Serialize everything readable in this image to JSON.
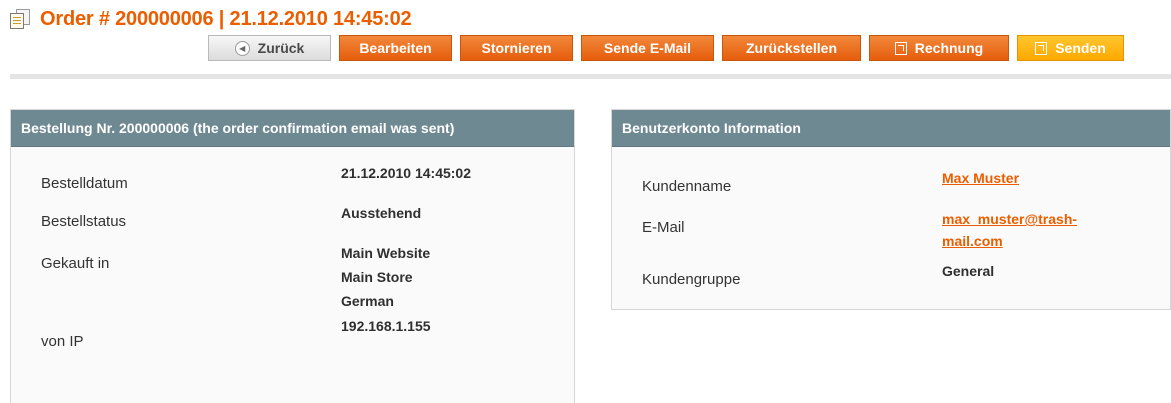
{
  "header": {
    "title": "Order # 200000006 | 21.12.2010 14:45:02",
    "icon": "order-document-icon"
  },
  "toolbar": {
    "back_label": "Zurück",
    "edit_label": "Bearbeiten",
    "cancel_label": "Stornieren",
    "send_email_label": "Sende E-Mail",
    "hold_label": "Zurückstellen",
    "invoice_label": "Rechnung",
    "ship_label": "Senden"
  },
  "order_box": {
    "heading": "Bestellung Nr. 200000006 (the order confirmation email was sent)",
    "rows": [
      {
        "label": "Bestelldatum",
        "value": "21.12.2010 14:45:02"
      },
      {
        "label": "Bestellstatus",
        "value": "Ausstehend"
      },
      {
        "label": "Gekauft in",
        "value_lines": [
          "Main Website",
          "Main Store",
          "German"
        ]
      },
      {
        "label": "von IP",
        "value": "192.168.1.155"
      }
    ]
  },
  "account_box": {
    "heading": "Benutzerkonto Information",
    "rows": [
      {
        "label": "Kundenname",
        "value": "Max Muster"
      },
      {
        "label": "E-Mail",
        "value_lines": [
          "max_muster@trash-",
          "mail.com"
        ]
      },
      {
        "label": "Kundengruppe",
        "value": "General"
      }
    ]
  },
  "colors": {
    "accent": "#eb5e00",
    "button_orange": "#e86a17",
    "button_primary": "#ffb000",
    "box_header": "#6f8992"
  }
}
